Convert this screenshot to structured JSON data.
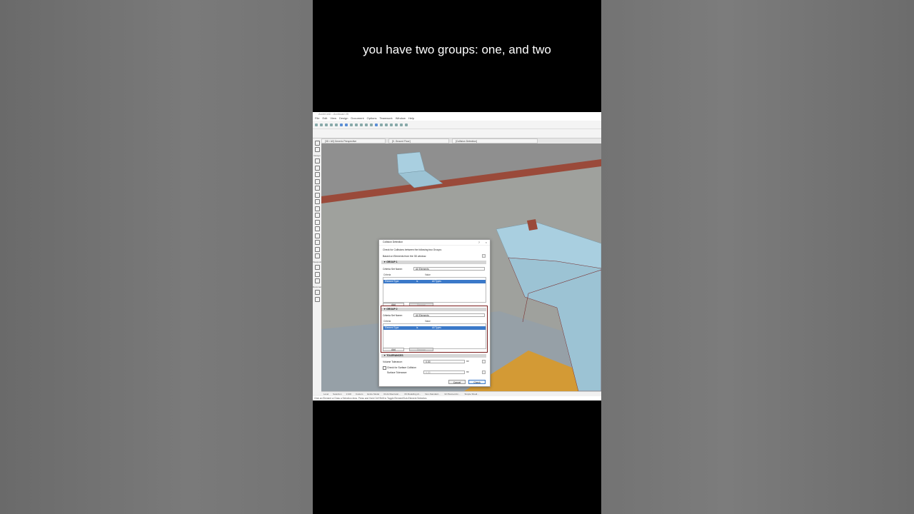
{
  "caption": "you have two groups: one, and two",
  "app": {
    "title": "ArchiCAD - Archicad 25",
    "menus": [
      "File",
      "Edit",
      "View",
      "Design",
      "Document",
      "Options",
      "Teamwork",
      "Window",
      "Help"
    ],
    "tabs": [
      "[3D / All] Generic Perspective",
      "[0. Ground Floor]",
      "[Collision Detection]"
    ],
    "toolbox_labels": [
      "Design",
      "Viewpoint",
      "Document"
    ],
    "status_items": [
      "Level",
      "Selection",
      "1:100",
      "Custom",
      "Entire Model",
      "04 Architectural...",
      "06 Modelling Al...",
      "Non-Standard...",
      "02 Planned An...",
      "Simple Shadi..."
    ],
    "hint": "Click an Element or Draw a Selection Area. Press and Hold Ctrl+Shift to Toggle Element/Sub-Element Selection."
  },
  "dialog": {
    "title": "Collision Detection",
    "help": "?",
    "close": "×",
    "intro": "Check for Collisions between the following two Groups:",
    "based_on": "Based on Elements from the 3D window.",
    "group1": {
      "header": "▼ GROUP 1",
      "criteria_set_label": "Criteria Set Name:",
      "criteria_set_value": "All Elements",
      "col_criteria": "Criteria",
      "col_value": "Value",
      "row_criteria": "Element Type",
      "row_op": "is",
      "row_value": "All Types",
      "add_label": "Add",
      "remove_label": "Remove"
    },
    "group2": {
      "header": "▼ GROUP 2",
      "criteria_set_label": "Criteria Set Name:",
      "criteria_set_value": "All Elements",
      "col_criteria": "Criteria",
      "col_value": "Value",
      "row_criteria": "Element Type",
      "row_op": "is",
      "row_value": "All Types",
      "add_label": "Add",
      "remove_label": "Remove"
    },
    "tolerances": {
      "header": "▼ TOLERANCES",
      "volume_label": "Volume Tolerance:",
      "volume_value": "0.00",
      "volume_unit": "m³",
      "surface_check_label": "Check for Surface Collision",
      "surface_label": "Surface Tolerance:",
      "surface_value": "0.00",
      "surface_unit": "m²"
    },
    "cancel_label": "Cancel",
    "check_label": "Check"
  },
  "colors": {
    "selection_blue": "#3b79c9",
    "group2_highlight": "#7a1b1b",
    "duct": "#a9cfe0",
    "brick": "#9a4a3a",
    "wall": "#9a9c98",
    "orange_floor": "#d39a35"
  }
}
